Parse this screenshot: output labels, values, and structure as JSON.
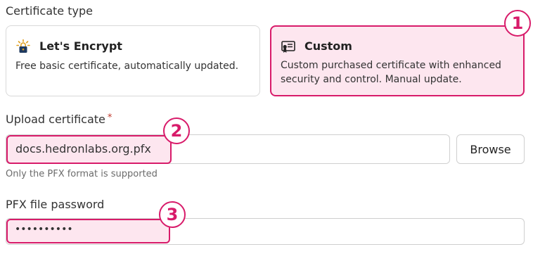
{
  "certificate_type": {
    "label": "Certificate type",
    "options": [
      {
        "title": "Let's Encrypt",
        "description": "Free basic certificate, automatically updated.",
        "icon": "lock-sun-icon",
        "selected": false
      },
      {
        "title": "Custom",
        "description_lines": [
          "Custom purchased certificate with enhanced",
          "security and control. Manual update."
        ],
        "icon": "certificate-icon",
        "selected": true
      }
    ]
  },
  "upload": {
    "label": "Upload certificate",
    "required_mark": "*",
    "value": "docs.hedronlabs.org.pfx",
    "browse_label": "Browse",
    "hint": "Only the PFX format is supported"
  },
  "password": {
    "label": "PFX file password",
    "value": "••••••••••"
  },
  "callouts": [
    "1",
    "2",
    "3"
  ],
  "colors": {
    "accent": "#d81b6a",
    "highlight_bg": "#fde6ef",
    "border": "#d9d9d9"
  }
}
